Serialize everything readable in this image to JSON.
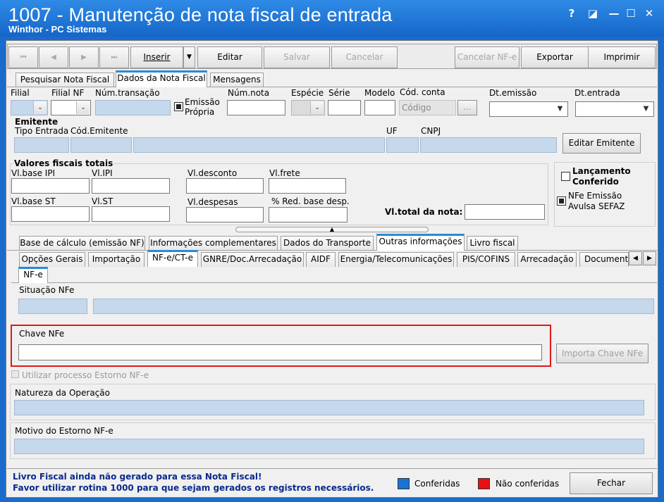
{
  "window": {
    "title": "1007 - Manutenção de nota fiscal de entrada",
    "subtitle": "Winthor - PC Sistemas",
    "help": "?",
    "restore": "◪",
    "minimize": "—",
    "maximize": "☐",
    "close": "✕"
  },
  "toolbar": {
    "first": "⏮",
    "prev": "◀",
    "next": "▶",
    "last": "⏭",
    "inserir": "Inserir",
    "inserir_dropdown": "▼",
    "editar": "Editar",
    "salvar": "Salvar",
    "cancelar": "Cancelar",
    "cancelar_nfe": "Cancelar NF-e",
    "exportar": "Exportar",
    "imprimir": "Imprimir"
  },
  "main_tabs": [
    "Pesquisar Nota Fiscal",
    "Dados da Nota Fiscal",
    "Mensagens"
  ],
  "header": {
    "filial": "Filial",
    "filial_nf": "Filial NF",
    "num_transacao": "Núm.transação",
    "emissao_propria": "Emissão Própria",
    "num_nota": "Núm.nota",
    "especie": "Espécie",
    "serie": "Série",
    "modelo": "Modelo",
    "cod_conta": "Cód. conta",
    "codigo_placeholder": "Código",
    "ellipsis": "...",
    "dt_emissao": "Dt.emissão",
    "dt_entrada": "Dt.entrada"
  },
  "emitente": {
    "title": "Emitente",
    "tipo_entrada": "Tipo Entrada",
    "cod_emitente": "Cód.Emitente",
    "uf": "UF",
    "cnpj": "CNPJ",
    "editar_button": "Editar Emitente"
  },
  "valores": {
    "title": "Valores fiscais totais",
    "vl_base_ipi": "Vl.base IPI",
    "vl_ipi": "Vl.IPI",
    "vl_desconto": "Vl.desconto",
    "vl_frete": "Vl.frete",
    "vl_base_st": "Vl.base ST",
    "vl_st": "Vl.ST",
    "vl_despesas": "Vl.despesas",
    "red_base_desp": "% Red. base desp.",
    "vl_total": "Vl.total da nota:"
  },
  "side": {
    "lancamento_conferido": "Lançamento Conferido",
    "nfe_emissao_avulsa": "NFe Emissão Avulsa SEFAZ"
  },
  "sub_tabs_1": [
    "Base de cálculo (emissão NF)",
    "Informações complementares",
    "Dados do Transporte",
    "Outras informações",
    "Livro fiscal"
  ],
  "sub_tabs_2": [
    "Opções Gerais",
    "Importação",
    "NF-e/CT-e",
    "GNRE/Doc.Arrecadação",
    "AIDF",
    "Energia/Telecomunicações",
    "PIS/COFINS",
    "Arrecadação",
    "Documentos"
  ],
  "inner_tab": "NF-e",
  "nfe": {
    "situacao": "Situação NFe",
    "chave": "Chave NFe",
    "importa_button": "Importa Chave NFe",
    "utilizar_estorno": "Utilizar processo Estorno NF-e",
    "natureza": "Natureza da Operação",
    "motivo": "Motivo do Estorno NF-e"
  },
  "footer": {
    "msg1": "Livro Fiscal ainda não gerado para essa Nota Fiscal!",
    "msg2": "Favor utilizar rotina 1000 para que sejam gerados os registros necessários.",
    "conferidas": "Conferidas",
    "nao_conferidas": "Não conferidas",
    "fechar": "Fechar"
  },
  "colors": {
    "titlebar": "#1a6bcc",
    "conferidas": "#1a73d4",
    "nao_conferidas": "#e81010",
    "highlight_border": "#e01818",
    "footer_text": "#0a2a8c"
  }
}
